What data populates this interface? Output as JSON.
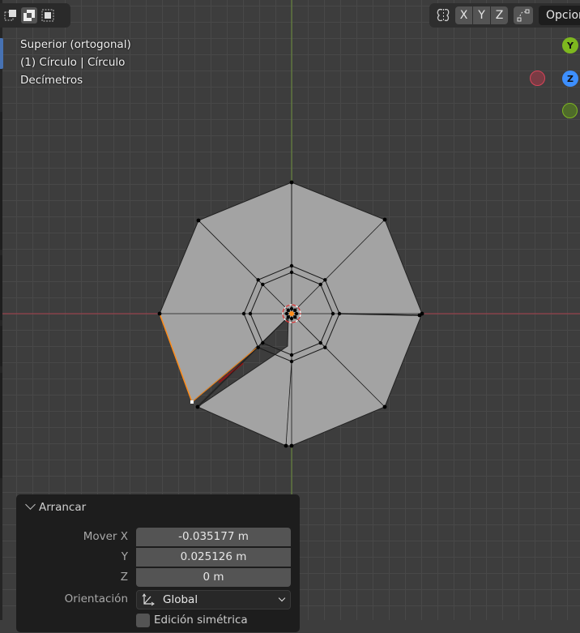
{
  "viewport": {
    "view_name": "Superior (ortogonal)",
    "object_info": "(1) Círculo | Círculo",
    "units": "Decímetros",
    "colors": {
      "background": "#3d3d3d",
      "grid": "#484848",
      "x_axis": "#a8404c",
      "y_axis": "#6b8f3a",
      "mesh_face": "#a3a3a3",
      "selected_edge": "#ff8c1a"
    }
  },
  "header": {
    "select_modes": [
      {
        "icon": "select-new-icon",
        "active": false
      },
      {
        "icon": "select-extend-icon",
        "active": true
      },
      {
        "icon": "select-subtract-icon",
        "active": false
      }
    ],
    "mirror_icon": "butterfly-mirror-icon",
    "axis_buttons": [
      "X",
      "Y",
      "Z"
    ],
    "snap_icon": "proportional-edit-icon",
    "options_label": "Opciones"
  },
  "gizmo": {
    "y": "Y",
    "z": "Z",
    "colors": {
      "x": "#d94459",
      "y": "#7eb81f",
      "z": "#3d8fff"
    }
  },
  "operator_panel": {
    "title": "Arrancar",
    "move_label": "Mover X",
    "fields": [
      {
        "label": "Mover X",
        "value": "-0.035177 m"
      },
      {
        "label": "Y",
        "value": "0.025126 m"
      },
      {
        "label": "Z",
        "value": "0 m"
      }
    ],
    "orientation_label": "Orientación",
    "orientation_value": "Global",
    "symmetric_label": "Edición simétrica"
  }
}
